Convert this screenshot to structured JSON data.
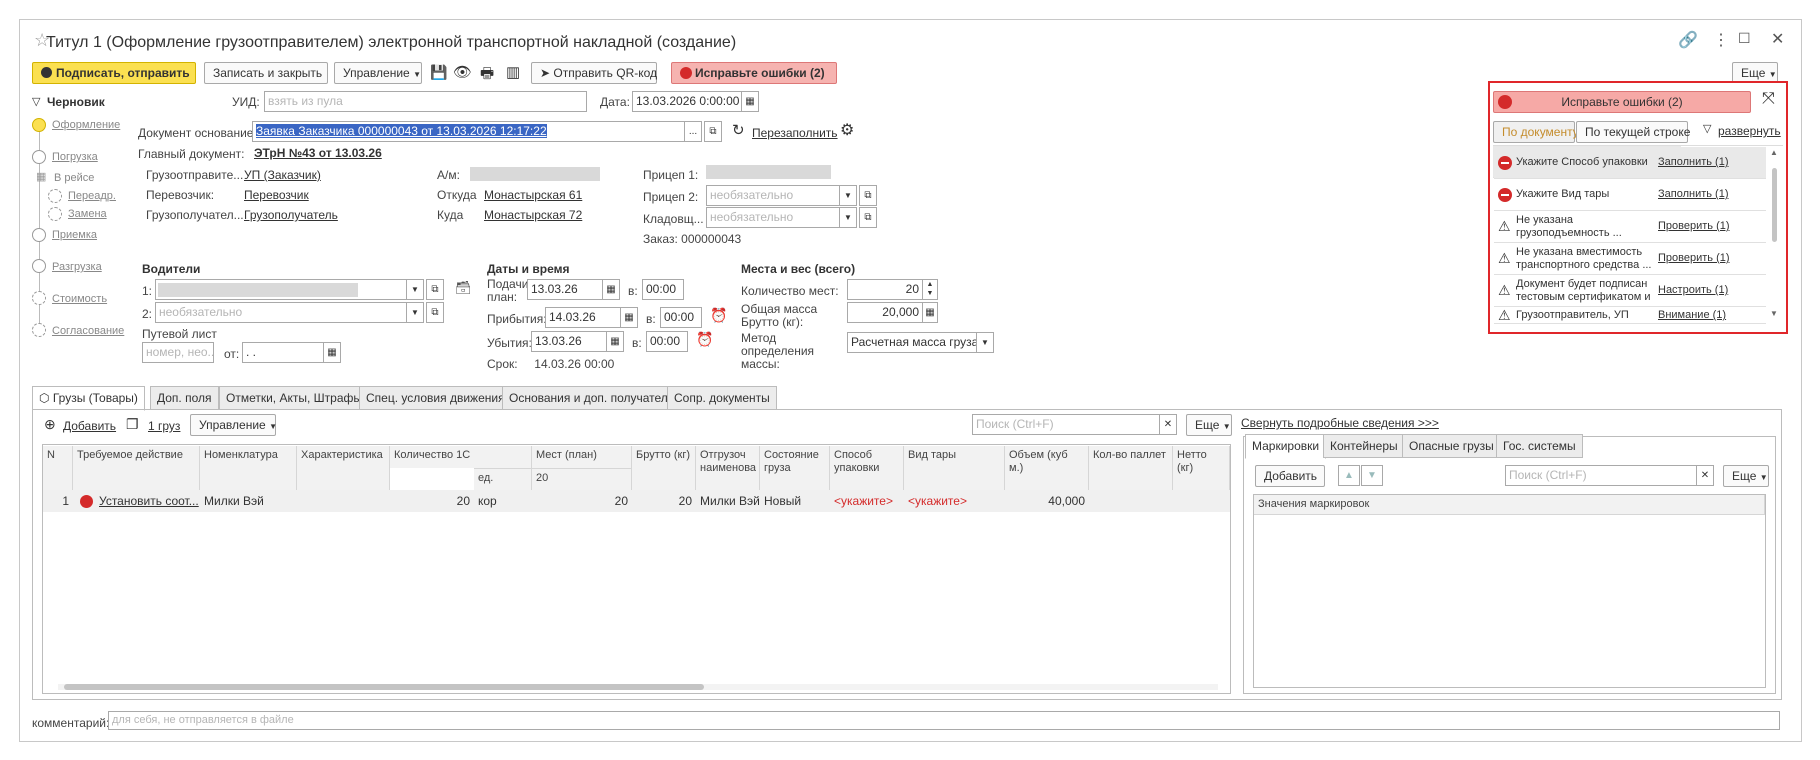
{
  "window": {
    "title": "Титул 1 (Оформление грузоотправителем) электронной транспортной накладной (создание)"
  },
  "toolbar": {
    "sign_send": "Подписать, отправить",
    "save_close": "Записать и закрыть",
    "manage": "Управление",
    "send_qr": "Отправить QR-код",
    "fix_errors": "Исправьте ошибки (2)",
    "more": "Еще"
  },
  "header": {
    "status": "Черновик",
    "uid_label": "УИД:",
    "uid_placeholder": "взять из пула",
    "date_label": "Дата:",
    "date_value": "13.03.2026  0:00:00",
    "basis_label": "Документ основание:",
    "basis_value": "Заявка Заказчика 000000043 от 13.03.2026 12:17:22",
    "refill": "Перезаполнить",
    "main_doc_label": "Главный документ:",
    "main_doc_value": "ЭТрН №43 от 13.03.26"
  },
  "steps": [
    {
      "label": "Оформление"
    },
    {
      "label": "Погрузка"
    },
    {
      "label": "В рейсе"
    },
    {
      "label": "Переадр."
    },
    {
      "label": "Замена"
    },
    {
      "label": "Приемка"
    },
    {
      "label": "Разгрузка"
    },
    {
      "label": "Стоимость"
    },
    {
      "label": "Согласование"
    }
  ],
  "parties": {
    "shipper_label": "Грузоотправите...",
    "shipper_value": "УП (Заказчик)",
    "carrier_label": "Перевозчик:",
    "carrier_value": "Перевозчик",
    "consignee_label": "Грузополучател...",
    "consignee_value": "Грузополучатель",
    "vehicle_label": "А/м:",
    "from_label": "Откуда",
    "from_value": "Монастырская 61",
    "to_label": "Куда",
    "to_value": "Монастырская 72",
    "trailer1_label": "Прицеп 1:",
    "trailer2_label": "Прицеп 2:",
    "trailer2_placeholder": "необязательно",
    "store_label": "Кладовщ...",
    "store_placeholder": "необязательно",
    "order_label": "Заказ: 000000043"
  },
  "drivers": {
    "title": "Водители",
    "d1": "1:",
    "d2": "2:",
    "d2_placeholder": "необязательно",
    "waybill_label": "Путевой лист",
    "waybill_placeholder": "номер, нео...",
    "from_label": "от:",
    "from_value": " .  .  "
  },
  "dates": {
    "title": "Даты и время",
    "submit_label": "Подачи план:",
    "submit_date": "13.03.26",
    "submit_time": "00:00",
    "arrive_label": "Прибытия:",
    "arrive_date": "14.03.26",
    "arrive_time": "00:00",
    "depart_label": "Убытия:",
    "depart_date": "13.03.26",
    "depart_time": "00:00",
    "at": "в:",
    "deadline": "Срок:     14.03.26 00:00"
  },
  "places": {
    "title": "Места и вес (всего)",
    "count_label": "Количество мест:",
    "count_value": "20",
    "gross_label": "Общая масса Брутто (кг):",
    "gross_value": "20,000",
    "method_label": "Метод определения массы:",
    "method_value": "Расчетная масса груза"
  },
  "tabs": [
    {
      "label": "Грузы (Товары)"
    },
    {
      "label": "Доп. поля"
    },
    {
      "label": "Отметки, Акты, Штрафы"
    },
    {
      "label": "Спец. условия движения"
    },
    {
      "label": "Основания и доп. получатели"
    },
    {
      "label": "Сопр. документы"
    }
  ],
  "goods": {
    "add": "Добавить",
    "count": "1 груз",
    "manage": "Управление",
    "search_placeholder": "Поиск (Ctrl+F)",
    "more": "Еще",
    "collapse_link": "Свернуть подробные сведения >>>",
    "columns": [
      "N",
      "Требуемое действие",
      "Номенклатура",
      "Характеристика",
      "Количество 1С",
      "Мест (план)",
      "Брутто (кг)",
      "Отгрузоч наименова",
      "Состояние груза",
      "Способ упаковки",
      "Вид тары",
      "Объем (куб м.)",
      "Кол-во паллет",
      "Нетто (кг)"
    ],
    "sub_unit": "ед.",
    "sub_places": "20",
    "row": {
      "n": "1",
      "action": "Установить соот...",
      "nomenclature": "Милки Вэй",
      "qty": "20",
      "unit": "кор",
      "places": "20",
      "gross": "20",
      "ship_name": "Милки Вэй",
      "state": "Новый",
      "pack": "<укажите>",
      "tare": "<укажите>",
      "volume": "40,000"
    }
  },
  "side_tabs": [
    {
      "label": "Маркировки"
    },
    {
      "label": "Контейнеры"
    },
    {
      "label": "Опасные грузы"
    },
    {
      "label": "Гос. системы"
    }
  ],
  "markings": {
    "add": "Добавить",
    "search_placeholder": "Поиск (Ctrl+F)",
    "more": "Еще",
    "column": "Значения маркировок"
  },
  "errors_panel": {
    "header": "Исправьте ошибки (2)",
    "by_doc": "По документу",
    "by_row": "По текущей строке",
    "expand": "развернуть",
    "items": [
      {
        "text": "Укажите Способ упаковки",
        "action": "Заполнить (1)",
        "kind": "error"
      },
      {
        "text": "Укажите Вид тары",
        "action": "Заполнить (1)",
        "kind": "error"
      },
      {
        "text": "Не указана грузоподъемность ...",
        "action": "Проверить (1)",
        "kind": "warn"
      },
      {
        "text": "Не указана вместимость транспортного средства ...",
        "action": "Проверить (1)",
        "kind": "warn"
      },
      {
        "text": "Документ будет подписан тестовым сертификатом и н...",
        "action": "Настроить (1)",
        "kind": "warn"
      },
      {
        "text": "Грузоотправитель, УП",
        "action": "Внимание (1)",
        "kind": "warn"
      }
    ]
  },
  "comment": {
    "label": "комментарий:",
    "placeholder": "для себя, не отправляется в файле"
  },
  "colors": {
    "accent_yellow": "#fbe051",
    "error_red": "#d42a2a",
    "panel_border": "#e0262a"
  }
}
